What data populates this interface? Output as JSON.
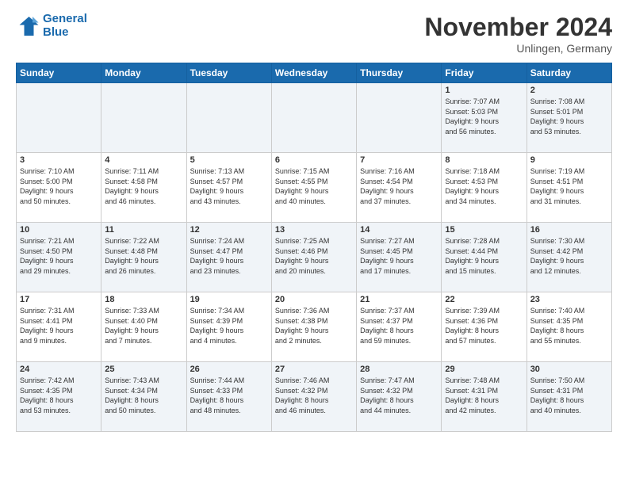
{
  "header": {
    "logo_line1": "General",
    "logo_line2": "Blue",
    "month": "November 2024",
    "location": "Unlingen, Germany"
  },
  "days_of_week": [
    "Sunday",
    "Monday",
    "Tuesday",
    "Wednesday",
    "Thursday",
    "Friday",
    "Saturday"
  ],
  "weeks": [
    [
      {
        "day": "",
        "info": ""
      },
      {
        "day": "",
        "info": ""
      },
      {
        "day": "",
        "info": ""
      },
      {
        "day": "",
        "info": ""
      },
      {
        "day": "",
        "info": ""
      },
      {
        "day": "1",
        "info": "Sunrise: 7:07 AM\nSunset: 5:03 PM\nDaylight: 9 hours\nand 56 minutes."
      },
      {
        "day": "2",
        "info": "Sunrise: 7:08 AM\nSunset: 5:01 PM\nDaylight: 9 hours\nand 53 minutes."
      }
    ],
    [
      {
        "day": "3",
        "info": "Sunrise: 7:10 AM\nSunset: 5:00 PM\nDaylight: 9 hours\nand 50 minutes."
      },
      {
        "day": "4",
        "info": "Sunrise: 7:11 AM\nSunset: 4:58 PM\nDaylight: 9 hours\nand 46 minutes."
      },
      {
        "day": "5",
        "info": "Sunrise: 7:13 AM\nSunset: 4:57 PM\nDaylight: 9 hours\nand 43 minutes."
      },
      {
        "day": "6",
        "info": "Sunrise: 7:15 AM\nSunset: 4:55 PM\nDaylight: 9 hours\nand 40 minutes."
      },
      {
        "day": "7",
        "info": "Sunrise: 7:16 AM\nSunset: 4:54 PM\nDaylight: 9 hours\nand 37 minutes."
      },
      {
        "day": "8",
        "info": "Sunrise: 7:18 AM\nSunset: 4:53 PM\nDaylight: 9 hours\nand 34 minutes."
      },
      {
        "day": "9",
        "info": "Sunrise: 7:19 AM\nSunset: 4:51 PM\nDaylight: 9 hours\nand 31 minutes."
      }
    ],
    [
      {
        "day": "10",
        "info": "Sunrise: 7:21 AM\nSunset: 4:50 PM\nDaylight: 9 hours\nand 29 minutes."
      },
      {
        "day": "11",
        "info": "Sunrise: 7:22 AM\nSunset: 4:48 PM\nDaylight: 9 hours\nand 26 minutes."
      },
      {
        "day": "12",
        "info": "Sunrise: 7:24 AM\nSunset: 4:47 PM\nDaylight: 9 hours\nand 23 minutes."
      },
      {
        "day": "13",
        "info": "Sunrise: 7:25 AM\nSunset: 4:46 PM\nDaylight: 9 hours\nand 20 minutes."
      },
      {
        "day": "14",
        "info": "Sunrise: 7:27 AM\nSunset: 4:45 PM\nDaylight: 9 hours\nand 17 minutes."
      },
      {
        "day": "15",
        "info": "Sunrise: 7:28 AM\nSunset: 4:44 PM\nDaylight: 9 hours\nand 15 minutes."
      },
      {
        "day": "16",
        "info": "Sunrise: 7:30 AM\nSunset: 4:42 PM\nDaylight: 9 hours\nand 12 minutes."
      }
    ],
    [
      {
        "day": "17",
        "info": "Sunrise: 7:31 AM\nSunset: 4:41 PM\nDaylight: 9 hours\nand 9 minutes."
      },
      {
        "day": "18",
        "info": "Sunrise: 7:33 AM\nSunset: 4:40 PM\nDaylight: 9 hours\nand 7 minutes."
      },
      {
        "day": "19",
        "info": "Sunrise: 7:34 AM\nSunset: 4:39 PM\nDaylight: 9 hours\nand 4 minutes."
      },
      {
        "day": "20",
        "info": "Sunrise: 7:36 AM\nSunset: 4:38 PM\nDaylight: 9 hours\nand 2 minutes."
      },
      {
        "day": "21",
        "info": "Sunrise: 7:37 AM\nSunset: 4:37 PM\nDaylight: 8 hours\nand 59 minutes."
      },
      {
        "day": "22",
        "info": "Sunrise: 7:39 AM\nSunset: 4:36 PM\nDaylight: 8 hours\nand 57 minutes."
      },
      {
        "day": "23",
        "info": "Sunrise: 7:40 AM\nSunset: 4:35 PM\nDaylight: 8 hours\nand 55 minutes."
      }
    ],
    [
      {
        "day": "24",
        "info": "Sunrise: 7:42 AM\nSunset: 4:35 PM\nDaylight: 8 hours\nand 53 minutes."
      },
      {
        "day": "25",
        "info": "Sunrise: 7:43 AM\nSunset: 4:34 PM\nDaylight: 8 hours\nand 50 minutes."
      },
      {
        "day": "26",
        "info": "Sunrise: 7:44 AM\nSunset: 4:33 PM\nDaylight: 8 hours\nand 48 minutes."
      },
      {
        "day": "27",
        "info": "Sunrise: 7:46 AM\nSunset: 4:32 PM\nDaylight: 8 hours\nand 46 minutes."
      },
      {
        "day": "28",
        "info": "Sunrise: 7:47 AM\nSunset: 4:32 PM\nDaylight: 8 hours\nand 44 minutes."
      },
      {
        "day": "29",
        "info": "Sunrise: 7:48 AM\nSunset: 4:31 PM\nDaylight: 8 hours\nand 42 minutes."
      },
      {
        "day": "30",
        "info": "Sunrise: 7:50 AM\nSunset: 4:31 PM\nDaylight: 8 hours\nand 40 minutes."
      }
    ]
  ]
}
